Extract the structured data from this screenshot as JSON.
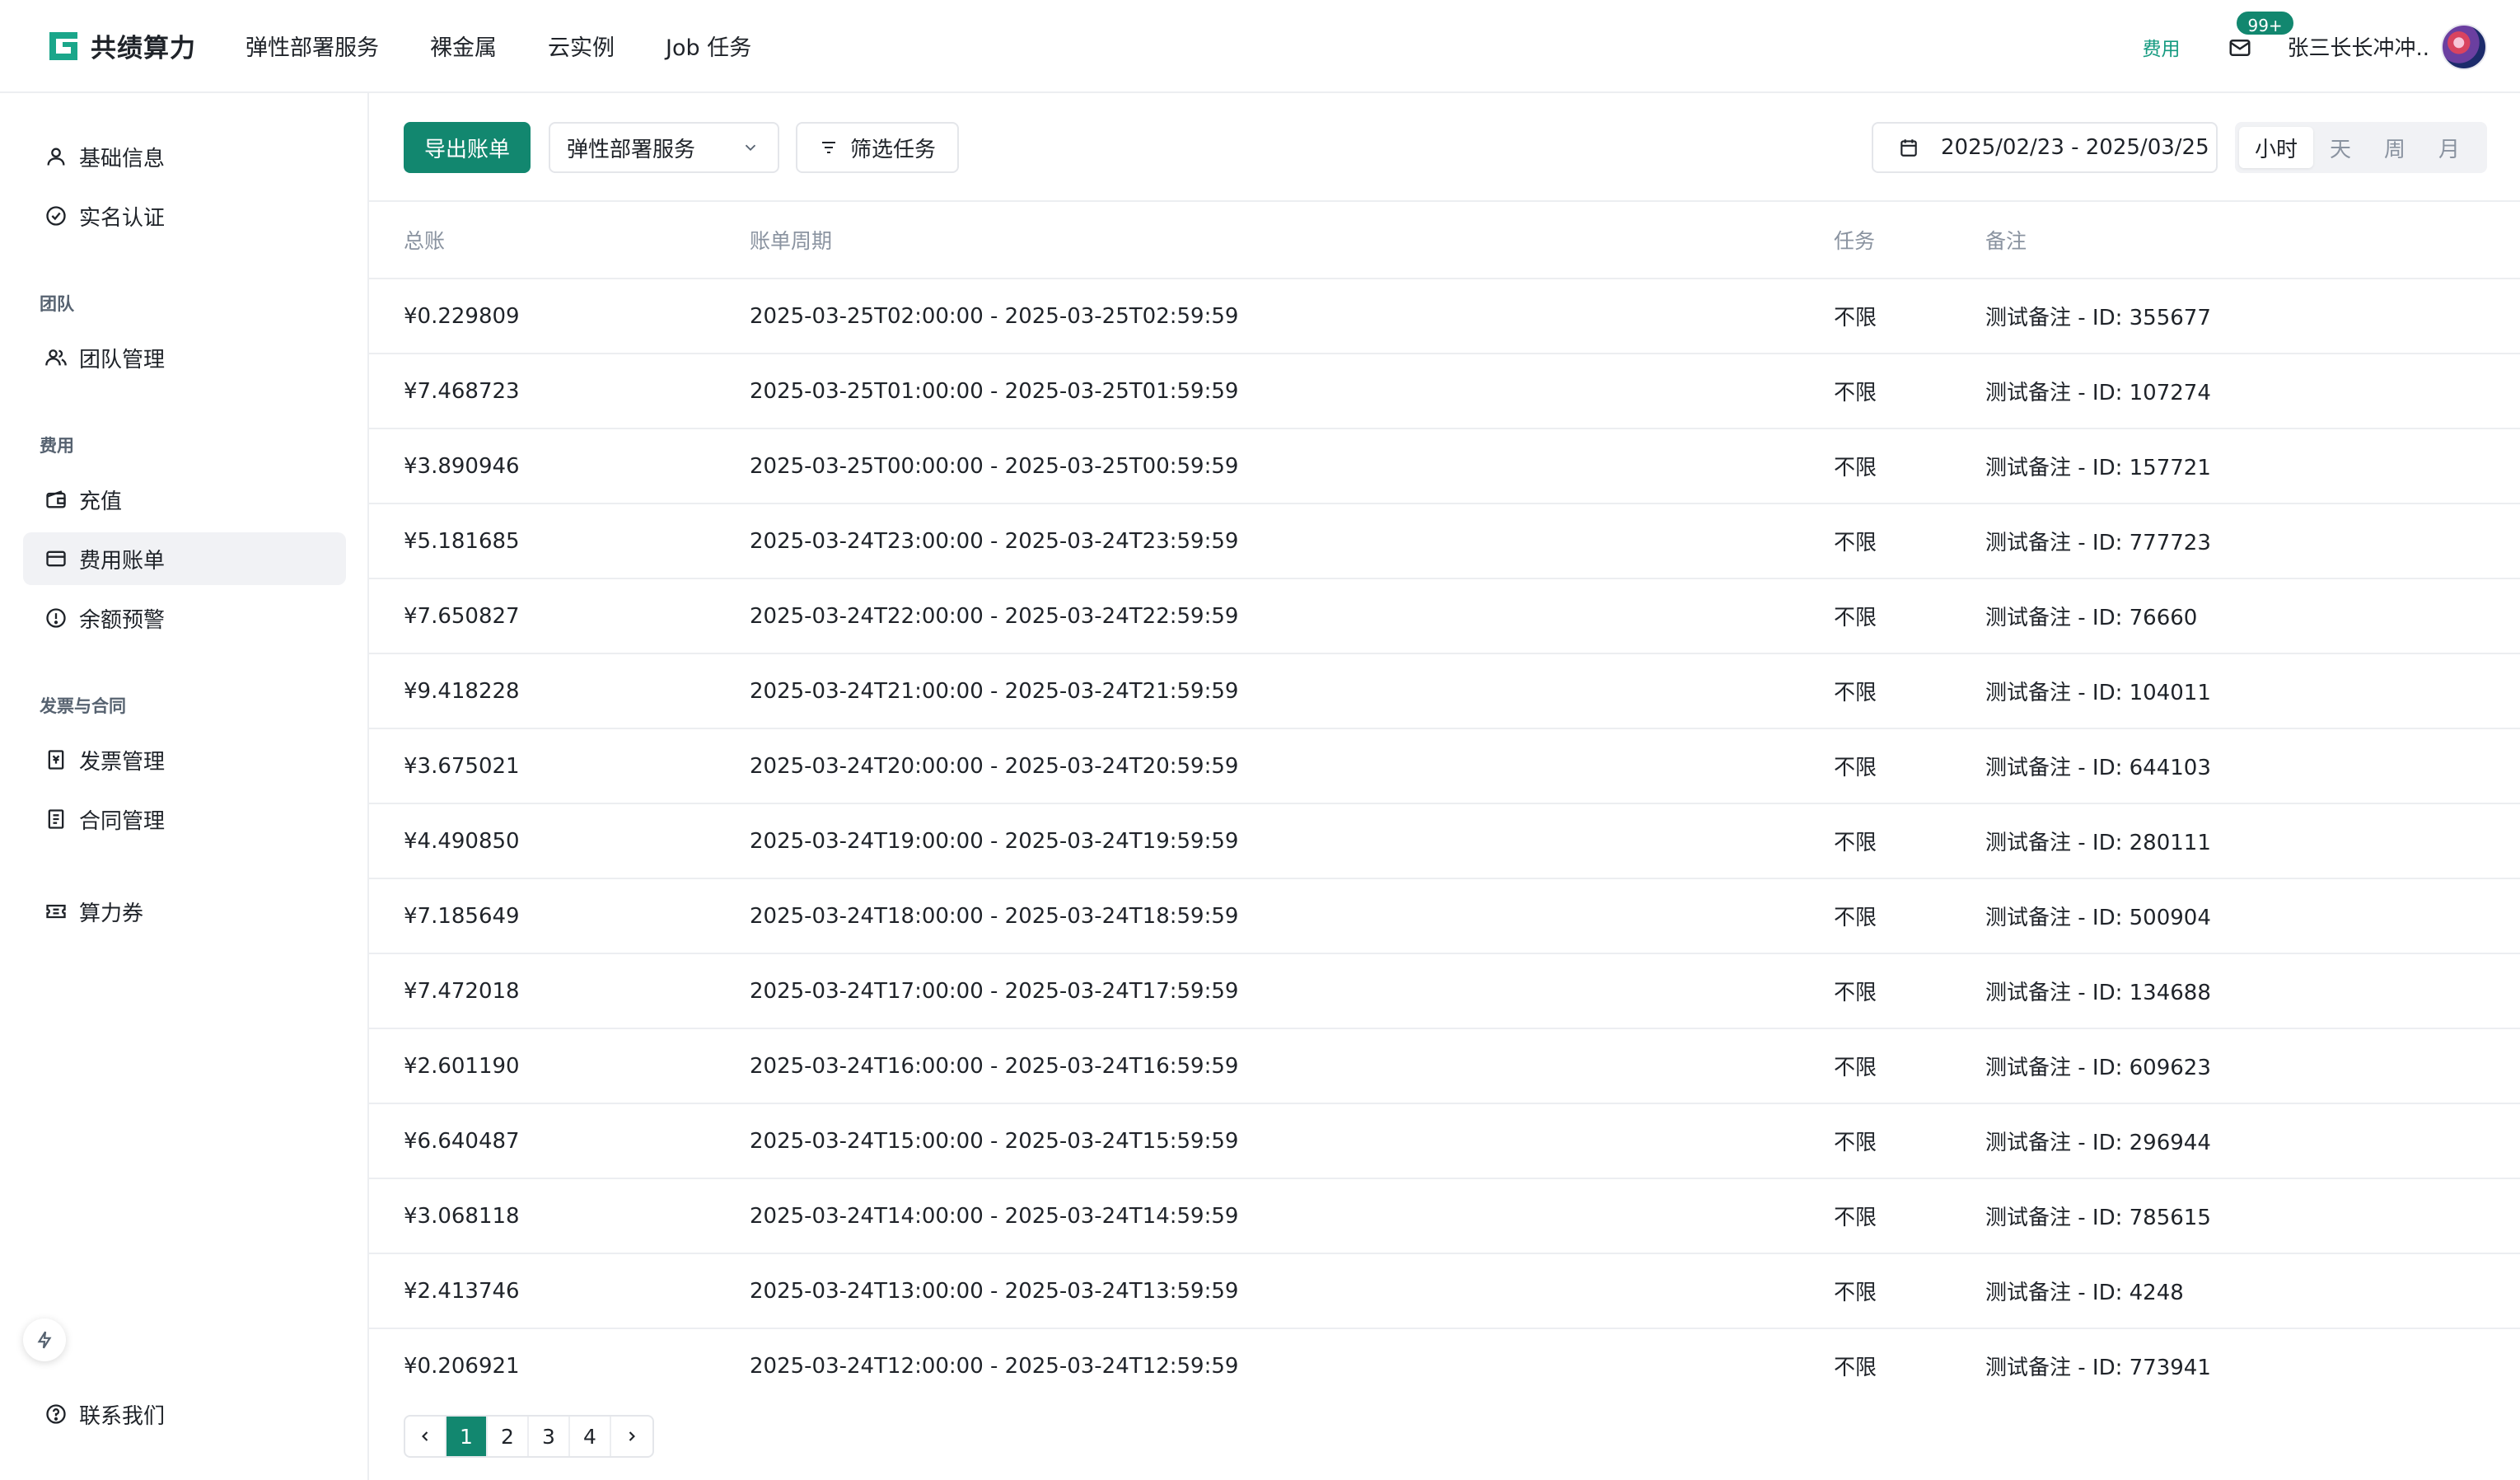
{
  "app": {
    "name": "共绩算力"
  },
  "nav": {
    "items": [
      "弹性部署服务",
      "裸金属",
      "云实例",
      "Job 任务"
    ]
  },
  "header": {
    "fee_link": "费用",
    "mail_badge": "99+",
    "user_name": "张三长长冲冲.."
  },
  "sidebar": {
    "items": [
      {
        "label": "基础信息",
        "icon": "user-icon"
      },
      {
        "label": "实名认证",
        "icon": "verified-icon"
      }
    ],
    "group_team": "团队",
    "team_items": [
      {
        "label": "团队管理",
        "icon": "team-icon"
      }
    ],
    "group_fee": "费用",
    "fee_items": [
      {
        "label": "充值",
        "icon": "wallet-icon"
      },
      {
        "label": "费用账单",
        "icon": "card-icon",
        "active": true
      },
      {
        "label": "余额预警",
        "icon": "alert-icon"
      }
    ],
    "group_invoice": "发票与合同",
    "invoice_items": [
      {
        "label": "发票管理",
        "icon": "invoice-icon"
      },
      {
        "label": "合同管理",
        "icon": "contract-icon"
      }
    ],
    "coupon": {
      "label": "算力券",
      "icon": "ticket-icon"
    },
    "contact": {
      "label": "联系我们",
      "icon": "help-icon"
    }
  },
  "toolbar": {
    "export_label": "导出账单",
    "service_select": "弹性部署服务",
    "filter_label": "筛选任务",
    "date_range": "2025/02/23 - 2025/03/25",
    "granularity": [
      "小时",
      "天",
      "周",
      "月"
    ],
    "granularity_selected": "小时"
  },
  "table": {
    "columns": [
      "总账",
      "账单周期",
      "任务",
      "备注"
    ],
    "rows": [
      [
        "¥0.229809",
        "2025-03-25T02:00:00 - 2025-03-25T02:59:59",
        "不限",
        "测试备注 - ID: 355677"
      ],
      [
        "¥7.468723",
        "2025-03-25T01:00:00 - 2025-03-25T01:59:59",
        "不限",
        "测试备注 - ID: 107274"
      ],
      [
        "¥3.890946",
        "2025-03-25T00:00:00 - 2025-03-25T00:59:59",
        "不限",
        "测试备注 - ID: 157721"
      ],
      [
        "¥5.181685",
        "2025-03-24T23:00:00 - 2025-03-24T23:59:59",
        "不限",
        "测试备注 - ID: 777723"
      ],
      [
        "¥7.650827",
        "2025-03-24T22:00:00 - 2025-03-24T22:59:59",
        "不限",
        "测试备注 - ID: 76660"
      ],
      [
        "¥9.418228",
        "2025-03-24T21:00:00 - 2025-03-24T21:59:59",
        "不限",
        "测试备注 - ID: 104011"
      ],
      [
        "¥3.675021",
        "2025-03-24T20:00:00 - 2025-03-24T20:59:59",
        "不限",
        "测试备注 - ID: 644103"
      ],
      [
        "¥4.490850",
        "2025-03-24T19:00:00 - 2025-03-24T19:59:59",
        "不限",
        "测试备注 - ID: 280111"
      ],
      [
        "¥7.185649",
        "2025-03-24T18:00:00 - 2025-03-24T18:59:59",
        "不限",
        "测试备注 - ID: 500904"
      ],
      [
        "¥7.472018",
        "2025-03-24T17:00:00 - 2025-03-24T17:59:59",
        "不限",
        "测试备注 - ID: 134688"
      ],
      [
        "¥2.601190",
        "2025-03-24T16:00:00 - 2025-03-24T16:59:59",
        "不限",
        "测试备注 - ID: 609623"
      ],
      [
        "¥6.640487",
        "2025-03-24T15:00:00 - 2025-03-24T15:59:59",
        "不限",
        "测试备注 - ID: 296944"
      ],
      [
        "¥3.068118",
        "2025-03-24T14:00:00 - 2025-03-24T14:59:59",
        "不限",
        "测试备注 - ID: 785615"
      ],
      [
        "¥2.413746",
        "2025-03-24T13:00:00 - 2025-03-24T13:59:59",
        "不限",
        "测试备注 - ID: 4248"
      ],
      [
        "¥0.206921",
        "2025-03-24T12:00:00 - 2025-03-24T12:59:59",
        "不限",
        "测试备注 - ID: 773941"
      ]
    ]
  },
  "pagination": {
    "pages": [
      "1",
      "2",
      "3",
      "4"
    ],
    "current": "1"
  },
  "colors": {
    "accent": "#12876f",
    "border": "#eceef1",
    "muted": "#8a93a0"
  }
}
